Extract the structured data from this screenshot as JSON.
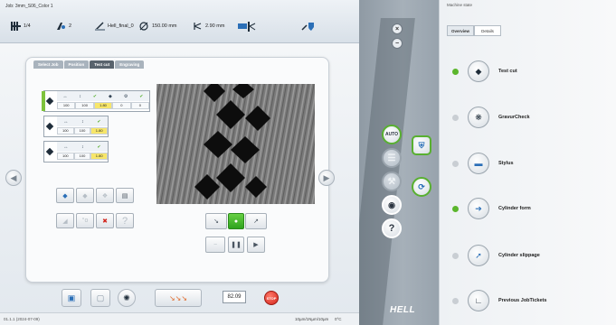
{
  "header": {
    "job_title": "Job: 3mm_S06_Color 1",
    "items": [
      {
        "label": "1/4",
        "icon": "cylinder-grid-icon"
      },
      {
        "label": "2",
        "icon": "stylus-count-icon"
      },
      {
        "label": "Hell_final_0",
        "icon": "file-icon"
      },
      {
        "label": "150.00 mm",
        "icon": "diameter-icon"
      },
      {
        "label": "2.90 mm",
        "icon": "depth-icon"
      },
      {
        "label": "",
        "icon": "engraving-head-icon"
      },
      {
        "label": "",
        "icon": "shield-wrench-icon"
      }
    ]
  },
  "main": {
    "tabs": [
      "Select Job",
      "Position",
      "Test cut",
      "Engraving"
    ],
    "active_tab": "Test cut",
    "stylus_rows": [
      {
        "values": [
          "100",
          "100",
          "1.80",
          "0",
          "0"
        ]
      },
      {
        "values": [
          "100",
          "100",
          "1.80"
        ]
      },
      {
        "values": [
          "100",
          "100",
          "1.80"
        ]
      }
    ],
    "value": "82.09",
    "stop_label": "STOP"
  },
  "status": {
    "version": "01.1.1 (2024-07-09)",
    "speed": "10µm/1Nµm/10µm",
    "temp": "0°C"
  },
  "middle": {
    "auto_label": "AUTO",
    "help": "?",
    "logo": "HELL"
  },
  "sidebar": {
    "title": "Machine state",
    "tabs": [
      "Overview",
      "Details"
    ],
    "items": [
      {
        "label": "Test cut",
        "status": "green"
      },
      {
        "label": "GravurCheck",
        "status": "grey"
      },
      {
        "label": "Stylus",
        "status": "grey"
      },
      {
        "label": "Cylinder form",
        "status": "green"
      },
      {
        "label": "Cylinder slippage",
        "status": "grey"
      },
      {
        "label": "Previous JobTickets",
        "status": "grey"
      }
    ]
  },
  "colors": {
    "accent_green": "#5bb62c",
    "highlight_yellow": "#f7e66a",
    "stop_red": "#d2231a"
  }
}
